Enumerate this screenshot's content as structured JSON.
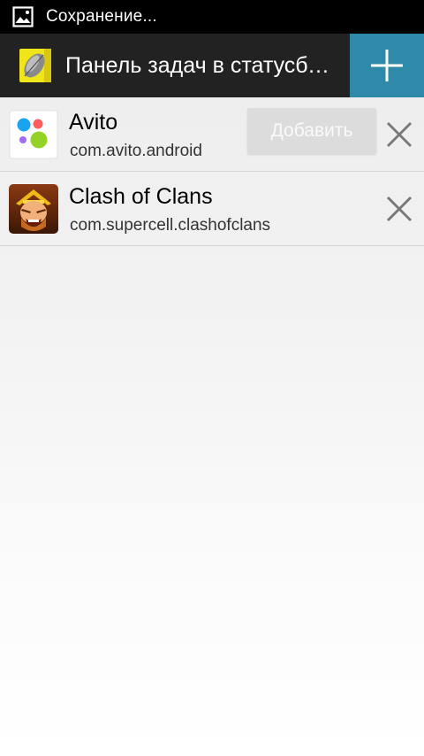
{
  "status_bar": {
    "icon": "image-icon",
    "text": "Сохранение..."
  },
  "action_bar": {
    "app_icon": "paint-leaf-icon",
    "title": "Панель задач в статусбаре",
    "add_icon": "plus-icon",
    "accent_color": "#2e8aa8"
  },
  "apps": [
    {
      "name": "Avito",
      "package": "com.avito.android",
      "icon": "avito-icon",
      "overlay_button": "Добавить",
      "remove_icon": "close-icon"
    },
    {
      "name": "Clash of Clans",
      "package": "com.supercell.clashofclans",
      "icon": "clash-of-clans-icon",
      "remove_icon": "close-icon"
    }
  ]
}
